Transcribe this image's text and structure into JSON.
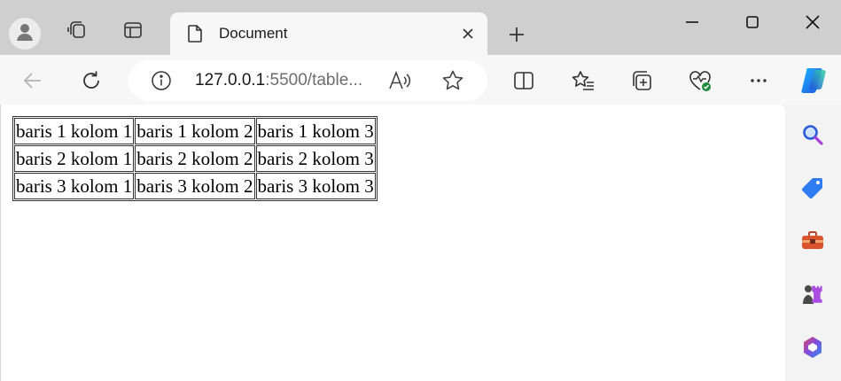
{
  "tab": {
    "title": "Document"
  },
  "address": {
    "host": "127.0.0.1",
    "path": ":5500/table..."
  },
  "table": {
    "rows": [
      [
        "baris 1 kolom 1",
        "baris 1 kolom 2",
        "baris 1 kolom 3"
      ],
      [
        "baris 2 kolom 1",
        "baris 2 kolom 2",
        "baris 2 kolom 3"
      ],
      [
        "baris 3 kolom 1",
        "baris 3 kolom 2",
        "baris 3 kolom 3"
      ]
    ]
  },
  "icons": {
    "titlebar": [
      "profile-avatar-icon",
      "workspaces-icon",
      "tab-actions-icon",
      "document-icon",
      "close-icon",
      "plus-icon",
      "minimize-icon",
      "maximize-icon",
      "window-close-icon"
    ],
    "toolbar": [
      "back-arrow-icon",
      "refresh-icon",
      "info-icon",
      "read-aloud-icon",
      "favorite-star-icon",
      "split-screen-icon",
      "favorites-icon",
      "collections-icon",
      "browser-essentials-icon",
      "more-icon",
      "copilot-icon"
    ],
    "sidebar": [
      "search-icon",
      "shopping-tag-icon",
      "tools-icon",
      "games-icon",
      "office-icon"
    ]
  },
  "colors": {
    "accent_blue": "#1f6fd6",
    "tab_bar": "#cfcfcf",
    "toolbar": "#f7f7f7",
    "content_bg": "#ffffff"
  }
}
